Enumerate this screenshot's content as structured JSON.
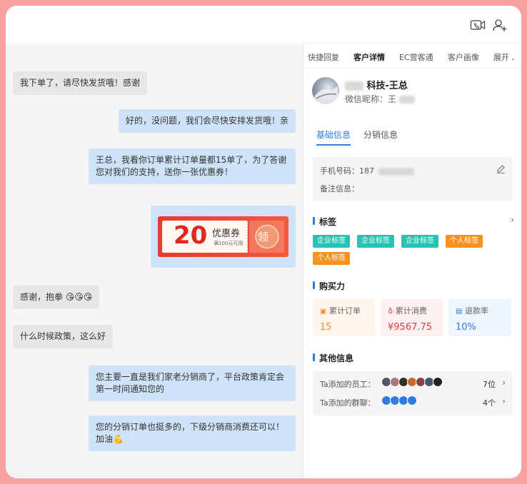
{
  "chat": {
    "messages": [
      {
        "side": "left",
        "text": "我下单了，请尽快发货哦！感谢"
      },
      {
        "side": "right",
        "text": "好的，没问题，我们会尽快安排发货哦！亲"
      },
      {
        "side": "right",
        "text": "王总，我看你订单累计订单量都15单了，为了答谢您对我们的支持，送你一张优惠券！"
      },
      {
        "side": "left",
        "text": "感谢，抱拳 😘😘😘"
      },
      {
        "side": "left",
        "text": "什么时候政策，这么好"
      },
      {
        "side": "right",
        "text": "您主要一直是我们家老分销商了，平台政策肯定会第一时间通知您的"
      },
      {
        "side": "right",
        "text": "您的分销订单也挺多的，下级分销商消费还可以！加油💪"
      }
    ],
    "coupon": {
      "amount": "20",
      "title": "优惠券",
      "condition": "满100元可用",
      "claim": "领"
    }
  },
  "panel": {
    "tabs": [
      "快捷回复",
      "客户详情",
      "EC营客通",
      "客户画像"
    ],
    "expand": "展开",
    "customer": {
      "name_suffix": "科技-王总",
      "nickname_label": "微信昵称：王"
    },
    "subtabs": [
      "基础信息",
      "分销信息"
    ],
    "info": {
      "phone_label": "手机号码：",
      "phone_prefix": "187",
      "note_label": "备注信息："
    },
    "tags_title": "标签",
    "tags": [
      {
        "label": "企业标签",
        "color": "#26c2b2"
      },
      {
        "label": "企业标签",
        "color": "#26c2b2"
      },
      {
        "label": "企业标签",
        "color": "#26c2b2"
      },
      {
        "label": "个人标签",
        "color": "#f7931e"
      },
      {
        "label": "个人标签",
        "color": "#f7931e"
      }
    ],
    "purchase_title": "购买力",
    "stats": [
      {
        "label": "累计订单",
        "value": "15",
        "color": "#f7931e"
      },
      {
        "label": "累计消费",
        "value": "¥9567.75",
        "color": "#e23b3b"
      },
      {
        "label": "退款率",
        "value": "10%",
        "color": "#2f7de1"
      }
    ],
    "other_title": "其他信息",
    "staff_label": "Ta添加的员工：",
    "staff_count": "7位",
    "group_label": "Ta添加的群聊：",
    "group_count": "4个"
  },
  "colors": {
    "accent": "#2f7de1",
    "frame": "#f7a3a3"
  }
}
